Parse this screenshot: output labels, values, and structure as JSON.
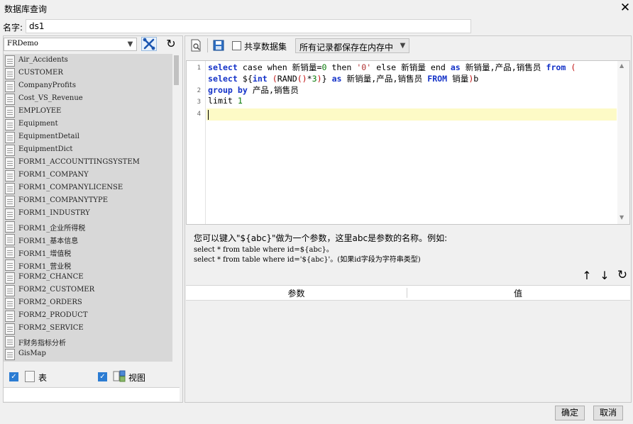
{
  "window": {
    "title": "数据库查询",
    "close": "✕"
  },
  "name": {
    "label": "名字:",
    "value": "ds1"
  },
  "left": {
    "database": "FRDemo",
    "tables": [
      "Air_Accidents",
      "CUSTOMER",
      "CompanyProfits",
      "Cost_VS_Revenue",
      "EMPLOYEE",
      "Equipment",
      "EquipmentDetail",
      "EquipmentDict",
      "FORM1_ACCOUNTTINGSYSTEM",
      "FORM1_COMPANY",
      "FORM1_COMPANYLICENSE",
      "FORM1_COMPANYTYPE",
      "FORM1_INDUSTRY",
      "FORM1_企业所得税",
      "FORM1_基本信息",
      "FORM1_增值税",
      "FORM1_营业税",
      "FORM2_CHANCE",
      "FORM2_CUSTOMER",
      "FORM2_ORDERS",
      "FORM2_PRODUCT",
      "FORM2_SERVICE",
      "F财务指标分析",
      "GisMap"
    ],
    "show_table_label": "表",
    "show_view_label": "视图"
  },
  "toolbar": {
    "share_label": "共享数据集",
    "memory_option": "所有记录都保存在内存中"
  },
  "editor": {
    "line_numbers": [
      "1",
      "2",
      "3",
      "4"
    ],
    "lines": [
      "select case when 新销量=0 then '0' else 新销量 end as 新销量,产品,销售员 from (",
      "select ${int (RAND()*3)} as 新销量,产品,销售员 FROM 销量)b",
      "group by 产品,销售员",
      "limit 1",
      ""
    ]
  },
  "hint": {
    "line1": "您可以键入\"${abc}\"做为一个参数，这里abc是参数的名称。例如:",
    "line2": "select * from table where id=${abc}。",
    "line3": "select * from table where id='${abc}'。(如果id字段为字符串类型)"
  },
  "params": {
    "col_param": "参数",
    "col_value": "值"
  },
  "buttons": {
    "ok": "确定",
    "cancel": "取消"
  }
}
